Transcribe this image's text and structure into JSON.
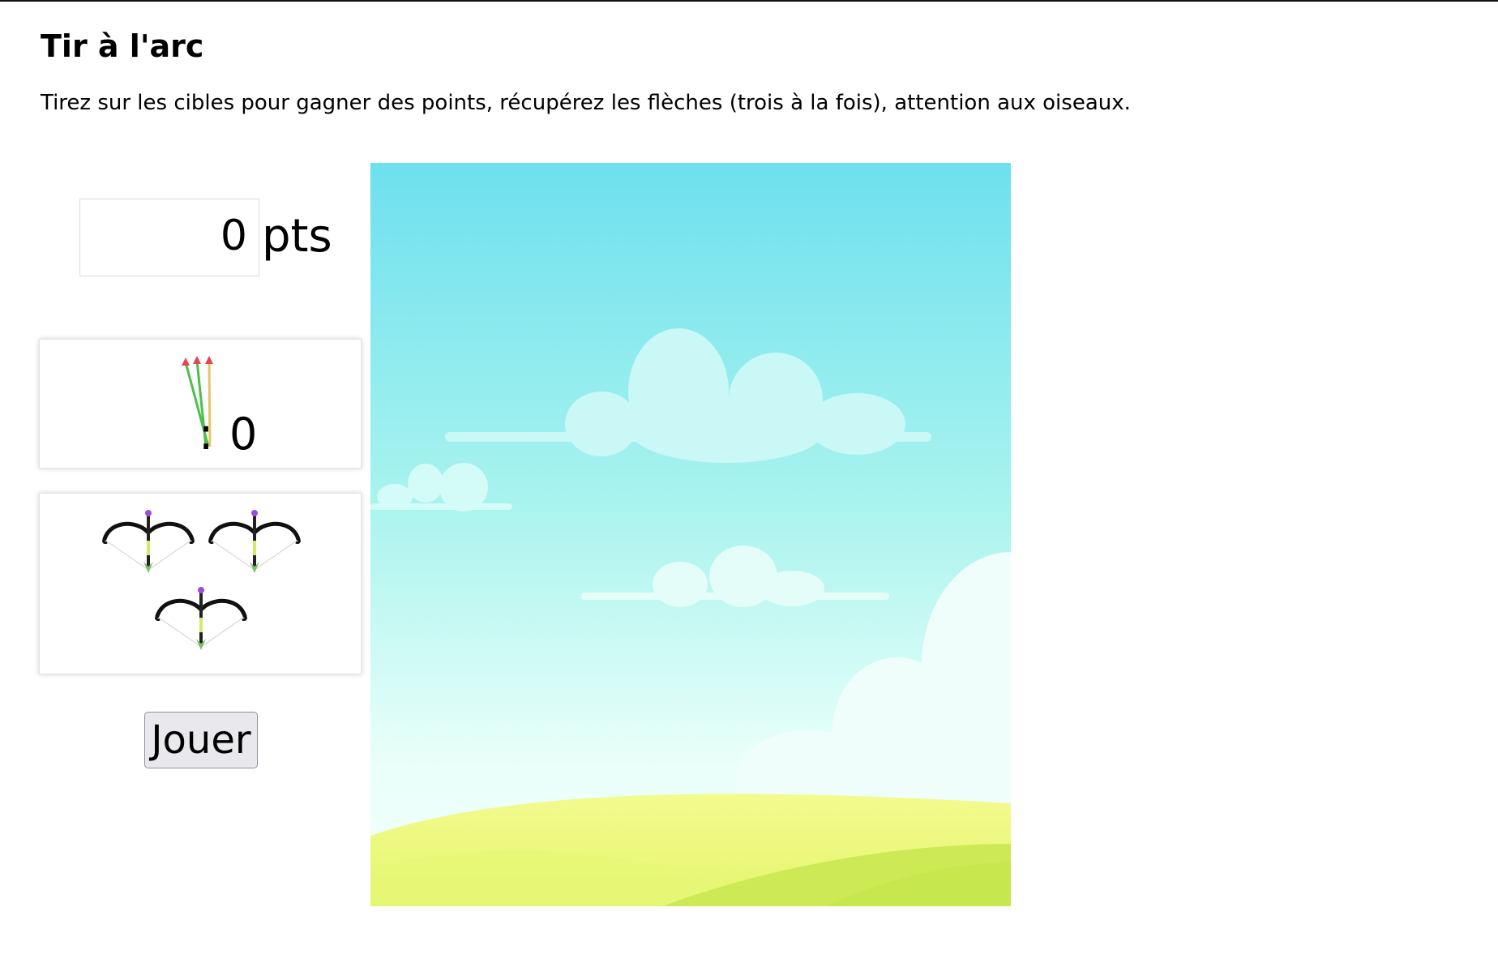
{
  "page": {
    "title": "Tir à l'arc",
    "description": "Tirez sur les cibles pour gagner des points, récupérez les flèches (trois à la fois), attention aux oiseaux."
  },
  "score": {
    "value": "0",
    "unit": "pts"
  },
  "arrows": {
    "icon": "arrows-bundle-icon",
    "separator": ":",
    "count": "0"
  },
  "lives": {
    "icon": "bow-icon",
    "count": 3
  },
  "controls": {
    "play_label": "Jouer"
  },
  "game_area": {
    "scene": "sky-clouds-hills",
    "colors": {
      "sky_top": "#6ee0ee",
      "sky_bottom": "#f2fff9",
      "cloud": "#c9f8f7",
      "hill_light": "#eef97e",
      "hill_dark": "#cdea56"
    }
  }
}
